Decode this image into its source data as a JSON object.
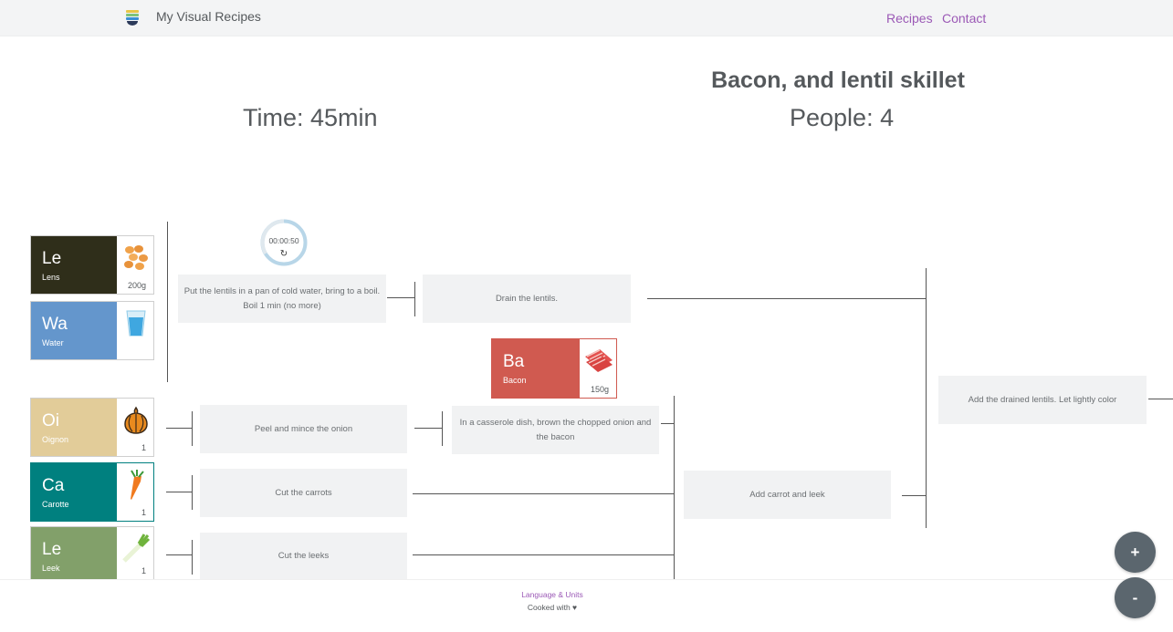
{
  "header": {
    "brand": "My Visual Recipes",
    "nav": [
      {
        "label": "Recipes"
      },
      {
        "label": "Contact"
      }
    ],
    "link_color": "#9b59b6"
  },
  "recipe": {
    "title": "Bacon, and lentil skillet",
    "time": "Time: 45min",
    "people": "People: 4"
  },
  "ingredients": [
    {
      "abbr": "Le",
      "name": "Lens",
      "qty": "200g",
      "color": "#2f2e1a",
      "icon": "lentils-icon"
    },
    {
      "abbr": "Wa",
      "name": "Water",
      "qty": "",
      "color": "#6496cc",
      "icon": "water-glass-icon"
    },
    {
      "abbr": "Ba",
      "name": "Bacon",
      "qty": "150g",
      "color": "#d05a50",
      "icon": "bacon-icon"
    },
    {
      "abbr": "Oi",
      "name": "Oignon",
      "qty": "1",
      "color": "#e2cc99",
      "icon": "onion-icon"
    },
    {
      "abbr": "Ca",
      "name": "Carotte",
      "qty": "1",
      "color": "#00807f",
      "icon": "carrot-icon"
    },
    {
      "abbr": "Le",
      "name": "Leek",
      "qty": "1",
      "color": "#82a06a",
      "icon": "leek-icon"
    }
  ],
  "timer": {
    "display": "00:00:50",
    "reset_icon": "reset-icon"
  },
  "steps": [
    {
      "text": "Put the lentils in a pan of cold water, bring to a boil. Boil 1 min (no more)"
    },
    {
      "text": "Drain the lentils."
    },
    {
      "text": "Peel and mince the onion"
    },
    {
      "text": "In a casserole dish, brown the chopped onion and the bacon"
    },
    {
      "text": "Cut the carrots"
    },
    {
      "text": "Cut the leeks"
    },
    {
      "text": "Add carrot and leek"
    },
    {
      "text": "Add the drained lentils. Let lightly color"
    }
  ],
  "footer": {
    "language": "Language & Units",
    "cooked": "Cooked with ♥"
  },
  "zoom": {
    "in": "+",
    "out": "-"
  }
}
